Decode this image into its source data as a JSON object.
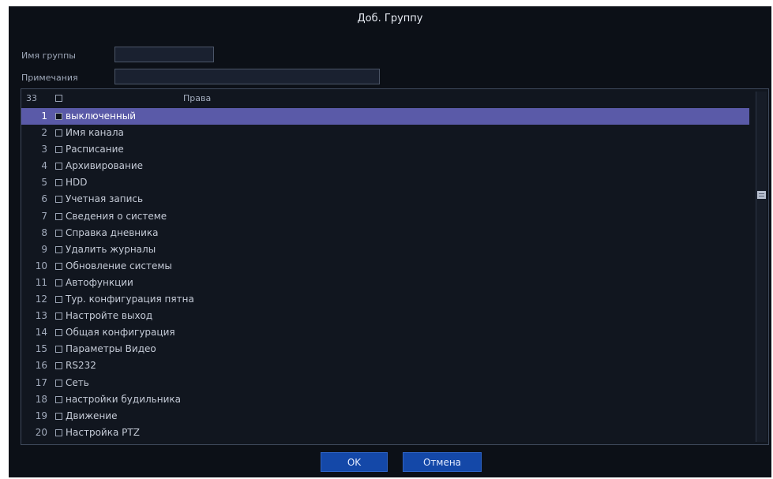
{
  "dialog": {
    "title": "Доб. Группу"
  },
  "form": {
    "group_name_label": "Имя группы",
    "group_name_value": "",
    "note_label": "Примечания",
    "note_value": ""
  },
  "list": {
    "count": "33",
    "header_title": "Права",
    "selected_index": 0,
    "rows": [
      {
        "num": "1",
        "label": "выключенный"
      },
      {
        "num": "2",
        "label": "Имя канала"
      },
      {
        "num": "3",
        "label": "Расписание"
      },
      {
        "num": "4",
        "label": "Архивирование"
      },
      {
        "num": "5",
        "label": "HDD"
      },
      {
        "num": "6",
        "label": "Учетная запись"
      },
      {
        "num": "7",
        "label": "Сведения о системе"
      },
      {
        "num": "8",
        "label": "Справка дневника"
      },
      {
        "num": "9",
        "label": "Удалить журналы"
      },
      {
        "num": "10",
        "label": "Обновление системы"
      },
      {
        "num": "11",
        "label": "Автофункции"
      },
      {
        "num": "12",
        "label": "Тур. конфигурация пятна"
      },
      {
        "num": "13",
        "label": "Настройте выход"
      },
      {
        "num": "14",
        "label": "Общая конфигурация"
      },
      {
        "num": "15",
        "label": "Параметры Видео"
      },
      {
        "num": "16",
        "label": "RS232"
      },
      {
        "num": "17",
        "label": "Сеть"
      },
      {
        "num": "18",
        "label": "настройки будильника"
      },
      {
        "num": "19",
        "label": "Движение"
      },
      {
        "num": "20",
        "label": "Настройка PTZ"
      }
    ]
  },
  "buttons": {
    "ok_label": "OK",
    "cancel_label": "Отмена"
  },
  "colors": {
    "background": "#0c1017",
    "selected_row": "#5a5aa8",
    "button": "#1448a8"
  }
}
